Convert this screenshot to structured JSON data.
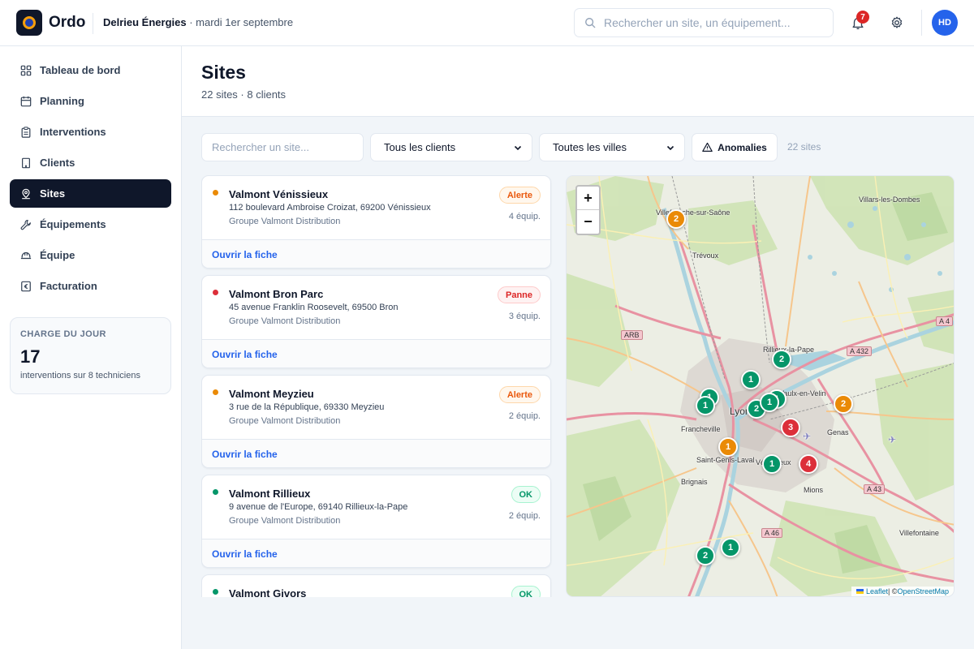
{
  "app": {
    "brand": "Ordo",
    "company": "Delrieu Énergies",
    "date": " · mardi 1er septembre"
  },
  "header": {
    "search_placeholder": "Rechercher un site, un équipement...",
    "notifications_count": "7",
    "avatar_initials": "HD"
  },
  "sidebar": {
    "items": [
      {
        "label": "Tableau de bord",
        "icon": "dashboard-icon"
      },
      {
        "label": "Planning",
        "icon": "calendar-icon"
      },
      {
        "label": "Interventions",
        "icon": "clipboard-icon"
      },
      {
        "label": "Clients",
        "icon": "building-icon"
      },
      {
        "label": "Sites",
        "icon": "map-pin-icon",
        "active": true
      },
      {
        "label": "Équipements",
        "icon": "wrench-icon"
      },
      {
        "label": "Équipe",
        "icon": "helmet-icon"
      },
      {
        "label": "Facturation",
        "icon": "euro-icon"
      }
    ],
    "charge": {
      "label": "CHARGE DU JOUR",
      "value": "17",
      "sub": "interventions sur 8 techniciens"
    }
  },
  "page": {
    "title": "Sites",
    "subtitle": "22 sites · 8 clients"
  },
  "filters": {
    "search_placeholder": "Rechercher un site...",
    "client_select": "Tous les clients",
    "city_select": "Toutes les villes",
    "anomalies_label": "Anomalies",
    "count": "22 sites"
  },
  "sites": [
    {
      "name": "Valmont Vénissieux",
      "address": "112 boulevard Ambroise Croizat, 69200 Vénissieux",
      "group": "Groupe Valmont Distribution",
      "status": "Alerte",
      "equip": "4 équip.",
      "link": "Ouvrir la fiche"
    },
    {
      "name": "Valmont Bron Parc",
      "address": "45 avenue Franklin Roosevelt, 69500 Bron",
      "group": "Groupe Valmont Distribution",
      "status": "Panne",
      "equip": "3 équip.",
      "link": "Ouvrir la fiche"
    },
    {
      "name": "Valmont Meyzieu",
      "address": "3 rue de la République, 69330 Meyzieu",
      "group": "Groupe Valmont Distribution",
      "status": "Alerte",
      "equip": "2 équip.",
      "link": "Ouvrir la fiche"
    },
    {
      "name": "Valmont Rillieux",
      "address": "9 avenue de l'Europe, 69140 Rillieux-la-Pape",
      "group": "Groupe Valmont Distribution",
      "status": "OK",
      "equip": "2 équip.",
      "link": "Ouvrir la fiche"
    },
    {
      "name": "Valmont Givors",
      "address": "",
      "group": "",
      "status": "OK",
      "equip": "",
      "link": ""
    }
  ],
  "map": {
    "zoom_in": "+",
    "zoom_out": "−",
    "attribution_leaflet": "Leaflet",
    "attribution_sep": " | © ",
    "attribution_osm": "OpenStreetMap",
    "place_labels": [
      "Villars-les-Dombes",
      "Villefranche-sur-Saône",
      "Trévoux",
      "Rillieux-la-Pape",
      "Vaulx-en-Velin",
      "Lyon",
      "Francheville",
      "Genas",
      "Saint-Genis-Laval",
      "Vénissieux",
      "Brignais",
      "Mions",
      "Villefontaine"
    ],
    "road_labels": [
      "ARB",
      "A 432",
      "A 43",
      "A 46",
      "A 4"
    ],
    "clusters": [
      {
        "count": "2",
        "status": "orange"
      },
      {
        "count": "2",
        "status": "green"
      },
      {
        "count": "1",
        "status": "green"
      },
      {
        "count": "1",
        "status": "green"
      },
      {
        "count": "1",
        "status": "green"
      },
      {
        "count": "2",
        "status": "green"
      },
      {
        "count": "1",
        "status": "green"
      },
      {
        "count": "1",
        "status": "green"
      },
      {
        "count": "2",
        "status": "orange"
      },
      {
        "count": "3",
        "status": "red"
      },
      {
        "count": "1",
        "status": "orange"
      },
      {
        "count": "1",
        "status": "green"
      },
      {
        "count": "4",
        "status": "red"
      },
      {
        "count": "1",
        "status": "green"
      },
      {
        "count": "2",
        "status": "green"
      }
    ]
  }
}
